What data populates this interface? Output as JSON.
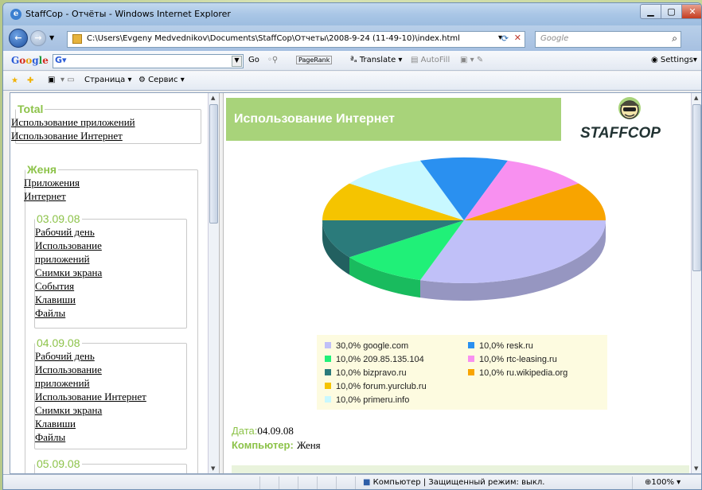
{
  "window": {
    "title": "StaffCop - Отчёты - Windows Internet Explorer"
  },
  "address": {
    "url": "C:\\Users\\Evgeny Medvednikov\\Documents\\StaffCop\\Отчеты\\2008-9-24 (11-49-10)\\index.html",
    "search_placeholder": "Google"
  },
  "google_toolbar": {
    "logo": "Google",
    "go": "Go",
    "pagerank": "PageRank",
    "translate": "Translate",
    "autofill": "AutoFill",
    "settings": "Settings"
  },
  "command_bar": {
    "page": "Страница",
    "tools": "Сервис"
  },
  "sidebar": {
    "total": {
      "legend": "Total",
      "links": [
        "Использование приложений",
        "Использование Интернет"
      ]
    },
    "user": {
      "legend": "Женя",
      "links": [
        "Приложения",
        "Интернет"
      ]
    },
    "days": [
      {
        "legend": "03.09.08",
        "links": [
          "Рабочий день",
          "Использование",
          "приложений",
          "Снимки экрана",
          "События",
          "Клавиши",
          "Файлы"
        ]
      },
      {
        "legend": "04.09.08",
        "links": [
          "Рабочий день",
          "Использование",
          "приложений",
          "Использование Интернет",
          "Снимки экрана",
          "Клавиши",
          "Файлы"
        ]
      },
      {
        "legend": "05.09.08",
        "links": []
      }
    ]
  },
  "report": {
    "header": "Использование Интернет",
    "logo_text": "STAFFCOP",
    "date_label": "Дата:",
    "date_value": "04.09.08",
    "computer_label": "Компьютер:",
    "computer_value": "Женя"
  },
  "chart_data": {
    "type": "pie",
    "series": [
      {
        "name": "google.com",
        "value": 30.0,
        "label": "30,0%",
        "color": "#c0c0f8"
      },
      {
        "name": "209.85.135.104",
        "value": 10.0,
        "label": "10,0%",
        "color": "#20f078"
      },
      {
        "name": "bizpravo.ru",
        "value": 10.0,
        "label": "10,0%",
        "color": "#2b7b7b"
      },
      {
        "name": "forum.yurclub.ru",
        "value": 10.0,
        "label": "10,0%",
        "color": "#f5c400"
      },
      {
        "name": "primeru.info",
        "value": 10.0,
        "label": "10,0%",
        "color": "#c8f8ff"
      },
      {
        "name": "resk.ru",
        "value": 10.0,
        "label": "10,0%",
        "color": "#2a90f0"
      },
      {
        "name": "rtc-leasing.ru",
        "value": 10.0,
        "label": "10,0%",
        "color": "#f890f0"
      },
      {
        "name": "ru.wikipedia.org",
        "value": 10.0,
        "label": "10,0%",
        "color": "#f8a400"
      }
    ]
  },
  "statusbar": {
    "zone": "Компьютер | Защищенный режим: выкл.",
    "zoom": "100%"
  }
}
